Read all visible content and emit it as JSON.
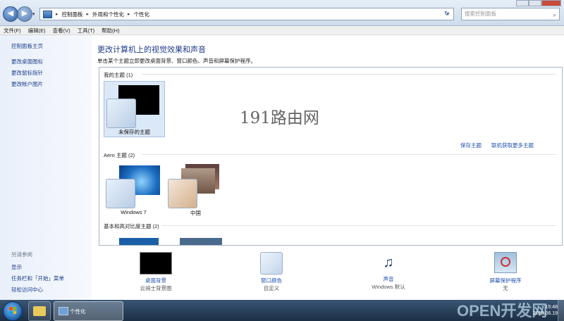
{
  "window": {
    "title": "个性化"
  },
  "address": {
    "crumbs": [
      "控制面板",
      "外观和个性化",
      "个性化"
    ],
    "search_placeholder": "搜索控制面板",
    "back_glyph": "◀",
    "forward_glyph": "▶",
    "dropdown_glyph": "▾",
    "separator": "▸",
    "refresh_glyph": "↻"
  },
  "menubar": [
    "文件(F)",
    "编辑(E)",
    "查看(V)",
    "工具(T)",
    "帮助(H)"
  ],
  "sidebar": {
    "home": "控制面板主页",
    "links": [
      "更改桌面图标",
      "更改鼠标指针",
      "更改帐户图片"
    ],
    "see_also_title": "另请参阅",
    "see_also": [
      "显示",
      "任务栏和「开始」菜单",
      "轻松访问中心"
    ]
  },
  "main": {
    "title": "更改计算机上的视觉效果和声音",
    "subtitle": "单击某个主题立即更改桌面背景、窗口颜色、声音和屏幕保护程序。",
    "my_themes": {
      "header": "我的主题 (1)",
      "items": [
        "未保存的主题"
      ]
    },
    "actions": {
      "save": "保存主题",
      "online": "联机获取更多主题"
    },
    "aero": {
      "header": "Aero 主题 (2)",
      "items": [
        "Windows 7",
        "中国"
      ]
    },
    "basic": {
      "header": "基本和高对比度主题 (2)"
    }
  },
  "bottom_tools": [
    {
      "label": "桌面背景",
      "sub": "云骑士背景图",
      "icon": "desktop-background-icon"
    },
    {
      "label": "窗口颜色",
      "sub": "自定义",
      "icon": "window-color-icon"
    },
    {
      "label": "声音",
      "sub": "Windows 默认",
      "icon": "sound-icon"
    },
    {
      "label": "屏幕保护程序",
      "sub": "无",
      "icon": "screensaver-icon"
    }
  ],
  "watermark": "191路由网",
  "watermark2": "OPEN开发网",
  "taskbar": {
    "window_button": "个性化",
    "time": "15:48",
    "date": "2018.06.19"
  },
  "colors": {
    "link": "#1d4eb0",
    "title": "#1e3a8a",
    "taskbar": "#1b2e44"
  }
}
